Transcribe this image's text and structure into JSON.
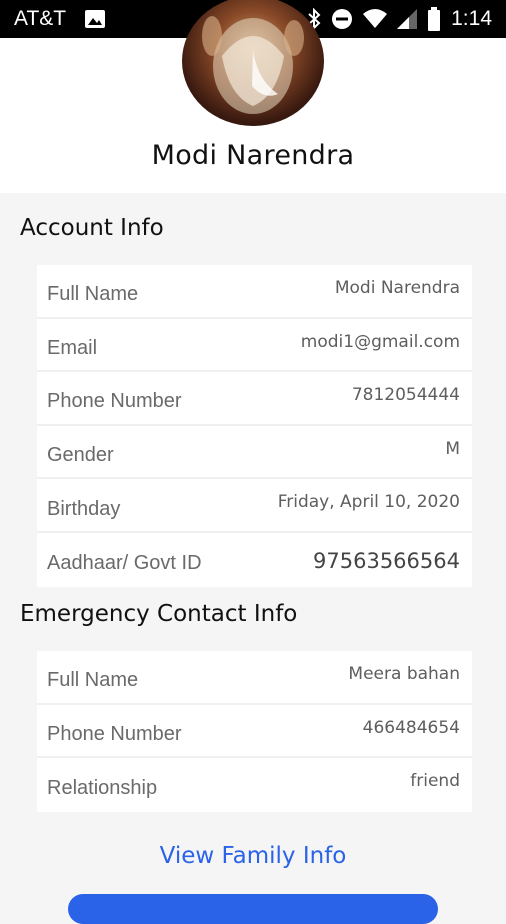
{
  "status_bar": {
    "carrier": "AT&T",
    "time": "1:14",
    "icons": [
      "image-icon",
      "bluetooth-icon",
      "do-not-disturb-icon",
      "wifi-icon",
      "signal-icon",
      "battery-icon"
    ]
  },
  "profile": {
    "name": "Modi Narendra"
  },
  "account_info": {
    "title": "Account Info",
    "rows": [
      {
        "label": "Full Name",
        "value": "Modi Narendra"
      },
      {
        "label": "Email",
        "value": "modi1@gmail.com"
      },
      {
        "label": "Phone Number",
        "value": "7812054444"
      },
      {
        "label": "Gender",
        "value": "M"
      },
      {
        "label": "Birthday",
        "value": "Friday, April 10, 2020"
      },
      {
        "label": "Aadhaar/ Govt ID",
        "value": "97563566564"
      }
    ]
  },
  "emergency_info": {
    "title": "Emergency Contact Info",
    "rows": [
      {
        "label": "Full Name",
        "value": "Meera bahan"
      },
      {
        "label": "Phone Number",
        "value": "466484654"
      },
      {
        "label": "Relationship",
        "value": "friend"
      }
    ]
  },
  "links": {
    "view_family": "View Family Info"
  },
  "colors": {
    "accent": "#2a62e8",
    "status_bar": "#000000",
    "background": "#f5f5f5"
  }
}
